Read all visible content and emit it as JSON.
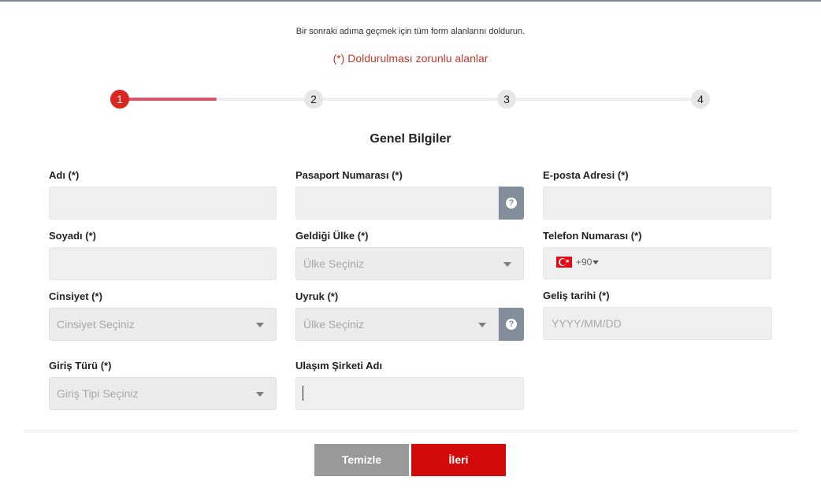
{
  "form": {
    "instruction": "Bir sonraki adıma geçmek için tüm form alanlarını doldurun.",
    "required_note": "(*) Doldurulması zorunlu alanlar",
    "steps": [
      {
        "number": "1",
        "active": true
      },
      {
        "number": "2",
        "active": false
      },
      {
        "number": "3",
        "active": false
      },
      {
        "number": "4",
        "active": false
      }
    ],
    "progress_within_first_segment": 0.5,
    "section_title": "Genel Bilgiler",
    "fields": {
      "first_name": {
        "label": "Adı (*)",
        "value": ""
      },
      "passport": {
        "label": "Pasaport Numarası (*)",
        "value": "",
        "help_icon": "question-icon"
      },
      "email": {
        "label": "E-posta Adresi (*)",
        "value": ""
      },
      "last_name": {
        "label": "Soyadı (*)",
        "value": ""
      },
      "origin_country": {
        "label": "Geldiği Ülke (*)",
        "selected": "Ülke Seçiniz"
      },
      "phone": {
        "label": "Telefon Numarası (*)",
        "country_flag": "turkey-flag",
        "dial_code": "+90",
        "value": ""
      },
      "gender": {
        "label": "Cinsiyet (*)",
        "selected": "Cinsiyet Seçiniz"
      },
      "nationality": {
        "label": "Uyruk (*)",
        "selected": "Ülke Seçiniz",
        "help_icon": "question-icon"
      },
      "arrival_date": {
        "label": "Geliş tarihi (*)",
        "placeholder": "YYYY/MM/DD"
      },
      "entry_type": {
        "label": "Giriş Türü (*)",
        "selected": "Giriş Tipi Seçiniz"
      },
      "transport_company": {
        "label": "Ulaşım Şirketi Adı",
        "value": ""
      }
    },
    "buttons": {
      "clear": "Temizle",
      "next": "İleri"
    }
  },
  "colors": {
    "active_step": "#d8281f",
    "progress": "#d65668",
    "required_note": "#c0392b",
    "next_button": "#d20a0a",
    "clear_button": "#999999",
    "help_button": "#838e9b"
  }
}
